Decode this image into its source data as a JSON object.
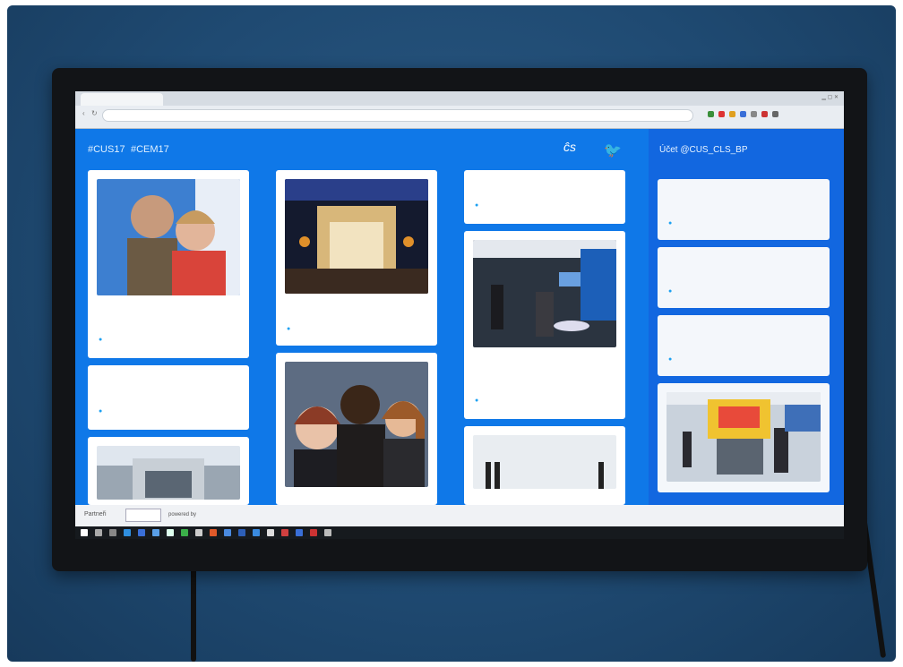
{
  "browser": {
    "tab_title": "",
    "address": ""
  },
  "app": {
    "hashtags": [
      "#CUS17",
      "#CEM17"
    ],
    "logo_text": "ĉs",
    "sidebar_title": "Účet @CUS_CLS_BP"
  },
  "feed": {
    "col1": [
      {
        "kind": "photo",
        "text": "",
        "handle": "",
        "time": ""
      },
      {
        "kind": "text",
        "text": "",
        "handle": "",
        "time": ""
      },
      {
        "kind": "photo",
        "text": "",
        "handle": "",
        "time": ""
      }
    ],
    "col2": [
      {
        "kind": "photo",
        "text": "",
        "handle": "",
        "time": ""
      },
      {
        "kind": "photo",
        "text": "",
        "handle": "",
        "time": ""
      }
    ],
    "col3": [
      {
        "kind": "text",
        "text": "",
        "handle": "",
        "time": ""
      },
      {
        "kind": "photo",
        "text": "",
        "handle": "",
        "time": ""
      },
      {
        "kind": "photo",
        "text": "",
        "handle": "",
        "time": ""
      }
    ]
  },
  "sidebar_cards": [
    {
      "text": "",
      "handle": "",
      "time": ""
    },
    {
      "text": "",
      "handle": "",
      "time": ""
    },
    {
      "text": "",
      "handle": "",
      "time": ""
    },
    {
      "kind": "photo"
    }
  ],
  "footer": {
    "partners_label": "Partneři",
    "brand": "",
    "powered": "powered by"
  },
  "colors": {
    "wall": "#1f4a72",
    "feed_bg": "#0f78e8",
    "sidebar_bg": "#1267e0",
    "twitter": "#1da1f2"
  }
}
